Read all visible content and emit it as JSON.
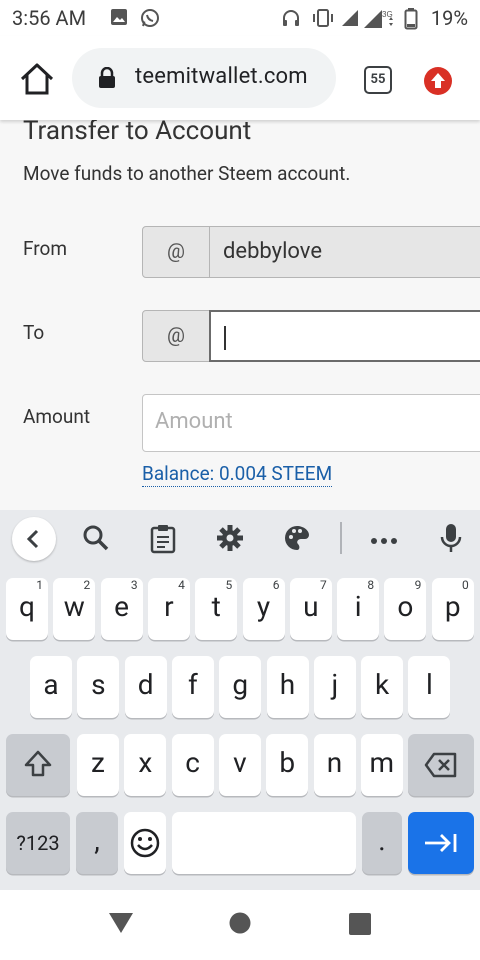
{
  "status_bar": {
    "time": "3:56 AM",
    "battery": "19%",
    "network": "3G",
    "icons": [
      "image-icon",
      "whatsapp-icon",
      "headset-icon",
      "vibrate-icon",
      "signal-icon",
      "data-arrows-icon",
      "battery-icon"
    ]
  },
  "browser": {
    "url": "teemitwallet.com",
    "tab_count": "55",
    "icons": [
      "home-icon",
      "lock-icon",
      "tab-switcher-icon",
      "update-icon"
    ]
  },
  "form": {
    "title": "Transfer to Account",
    "subtitle": "Move funds to another Steem account.",
    "from_label": "From",
    "from_prefix": "@",
    "from_value": "debbylove",
    "to_label": "To",
    "to_prefix": "@",
    "to_value": "",
    "amount_label": "Amount",
    "amount_placeholder": "Amount",
    "balance_text": "Balance: 0.004 STEEM"
  },
  "keyboard": {
    "toolbar_icons": [
      "back-chevron-icon",
      "search-icon",
      "clipboard-icon",
      "settings-gear-icon",
      "theme-palette-icon",
      "more-icon",
      "microphone-icon"
    ],
    "row1": [
      {
        "k": "q",
        "h": "1"
      },
      {
        "k": "w",
        "h": "2"
      },
      {
        "k": "e",
        "h": "3"
      },
      {
        "k": "r",
        "h": "4"
      },
      {
        "k": "t",
        "h": "5"
      },
      {
        "k": "y",
        "h": "6"
      },
      {
        "k": "u",
        "h": "7"
      },
      {
        "k": "i",
        "h": "8"
      },
      {
        "k": "o",
        "h": "9"
      },
      {
        "k": "p",
        "h": "0"
      }
    ],
    "row2": [
      "a",
      "s",
      "d",
      "f",
      "g",
      "h",
      "j",
      "k",
      "l"
    ],
    "row3": [
      "z",
      "x",
      "c",
      "v",
      "b",
      "n",
      "m"
    ],
    "symbols_label": "?123",
    "comma": ",",
    "period": ".",
    "accent_color": "#1a73e8"
  },
  "nav_bar": {
    "icons": [
      "back-triangle-icon",
      "home-circle-icon",
      "recents-square-icon"
    ]
  }
}
